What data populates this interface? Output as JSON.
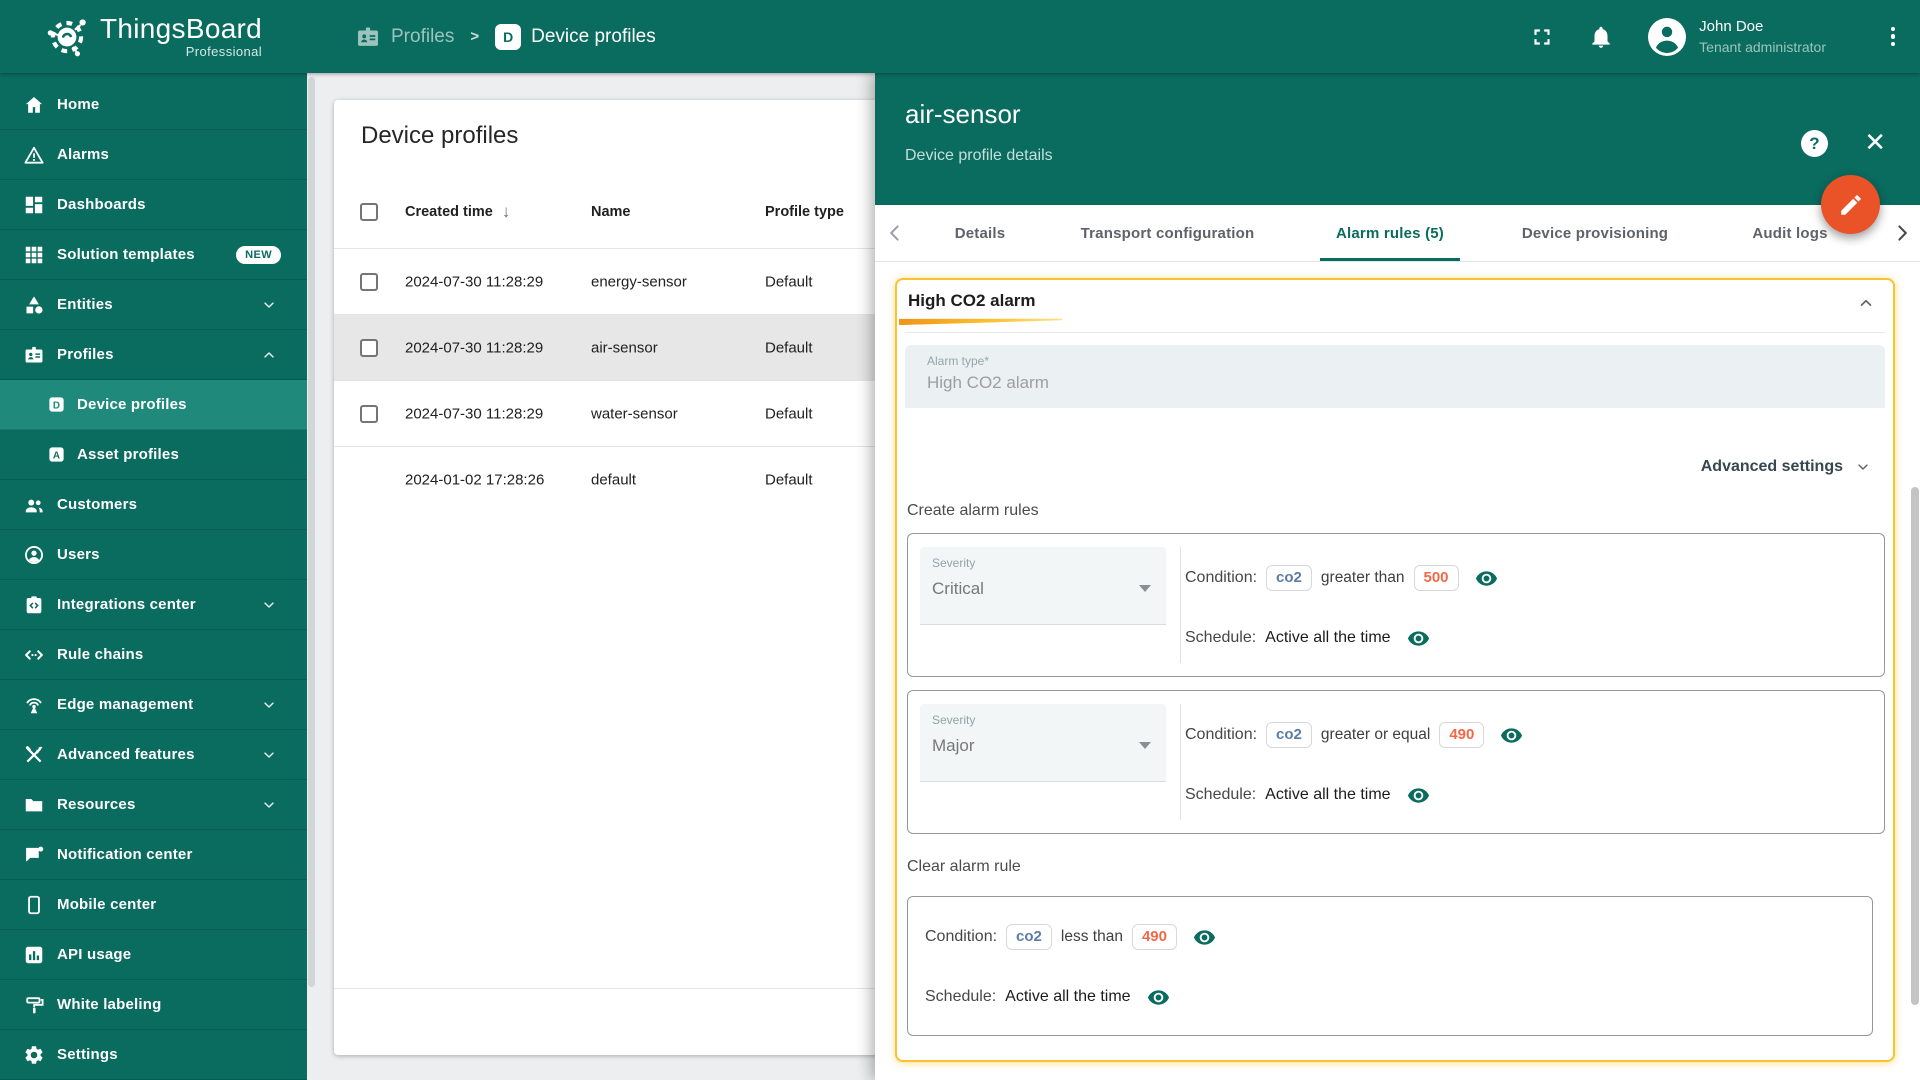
{
  "app": {
    "name": "ThingsBoard",
    "edition": "Professional"
  },
  "header": {
    "breadcrumb": {
      "parent": "Profiles",
      "separator": ">",
      "current": "Device profiles"
    },
    "user": {
      "name": "John Doe",
      "role": "Tenant administrator"
    }
  },
  "sidebar": {
    "items": [
      {
        "label": "Home",
        "icon": "home-icon"
      },
      {
        "label": "Alarms",
        "icon": "alarms-icon"
      },
      {
        "label": "Dashboards",
        "icon": "dashboards-icon"
      },
      {
        "label": "Solution templates",
        "icon": "solution-templates-icon",
        "badge": "NEW"
      },
      {
        "label": "Entities",
        "icon": "entities-icon",
        "chevron": "down"
      },
      {
        "label": "Profiles",
        "icon": "profiles-icon",
        "chevron": "up"
      },
      {
        "label": "Device profiles",
        "icon": "device-profiles-icon",
        "sub": true,
        "active": true
      },
      {
        "label": "Asset profiles",
        "icon": "asset-profiles-icon",
        "sub": true
      },
      {
        "label": "Customers",
        "icon": "customers-icon"
      },
      {
        "label": "Users",
        "icon": "users-icon"
      },
      {
        "label": "Integrations center",
        "icon": "integrations-center-icon",
        "chevron": "down"
      },
      {
        "label": "Rule chains",
        "icon": "rule-chains-icon"
      },
      {
        "label": "Edge management",
        "icon": "edge-management-icon",
        "chevron": "down"
      },
      {
        "label": "Advanced features",
        "icon": "advanced-features-icon",
        "chevron": "down"
      },
      {
        "label": "Resources",
        "icon": "resources-icon",
        "chevron": "down"
      },
      {
        "label": "Notification center",
        "icon": "notification-center-icon"
      },
      {
        "label": "Mobile center",
        "icon": "mobile-center-icon"
      },
      {
        "label": "API usage",
        "icon": "api-usage-icon"
      },
      {
        "label": "White labeling",
        "icon": "white-labeling-icon"
      },
      {
        "label": "Settings",
        "icon": "settings-icon"
      }
    ]
  },
  "table": {
    "title": "Device profiles",
    "sort_icon": "↓",
    "columns": {
      "created": "Created time",
      "name": "Name",
      "profile_type": "Profile type"
    },
    "rows": [
      {
        "created": "2024-07-30 11:28:29",
        "name": "energy-sensor",
        "profile_type": "Default"
      },
      {
        "created": "2024-07-30 11:28:29",
        "name": "air-sensor",
        "profile_type": "Default"
      },
      {
        "created": "2024-07-30 11:28:29",
        "name": "water-sensor",
        "profile_type": "Default"
      },
      {
        "created": "2024-01-02 17:28:26",
        "name": "default",
        "profile_type": "Default"
      }
    ]
  },
  "panel": {
    "title": "air-sensor",
    "subtitle": "Device profile details",
    "icons": {
      "help": "?",
      "close": "✕"
    },
    "tabs": [
      {
        "label": "Details"
      },
      {
        "label": "Transport configuration"
      },
      {
        "label": "Alarm rules (5)",
        "active": true
      },
      {
        "label": "Device provisioning"
      },
      {
        "label": "Audit logs"
      }
    ],
    "alarm": {
      "name": "High CO2 alarm",
      "type_label": "Alarm type*",
      "type_value": "High CO2 alarm",
      "advanced_settings": "Advanced settings",
      "create_rules_label": "Create alarm rules",
      "severity_label": "Severity",
      "rules": [
        {
          "severity": "Critical",
          "condition_label": "Condition:",
          "key": "co2",
          "operator": "greater than",
          "value": "500",
          "schedule_label": "Schedule:",
          "schedule": "Active all the time"
        },
        {
          "severity": "Major",
          "condition_label": "Condition:",
          "key": "co2",
          "operator": "greater or equal",
          "value": "490",
          "schedule_label": "Schedule:",
          "schedule": "Active all the time"
        }
      ],
      "clear_rule_label": "Clear alarm rule",
      "clear_rule": {
        "condition_label": "Condition:",
        "key": "co2",
        "operator": "less than",
        "value": "490",
        "schedule_label": "Schedule:",
        "schedule": "Active all the time"
      }
    }
  },
  "colors": {
    "primary": "#0a6b5f",
    "sidebar_active": "#1f8a7c",
    "fab": "#ea5228",
    "highlight_border": "#f9c22e",
    "chip_key_text": "#5b7ca8",
    "chip_value_text": "#f2694a"
  }
}
